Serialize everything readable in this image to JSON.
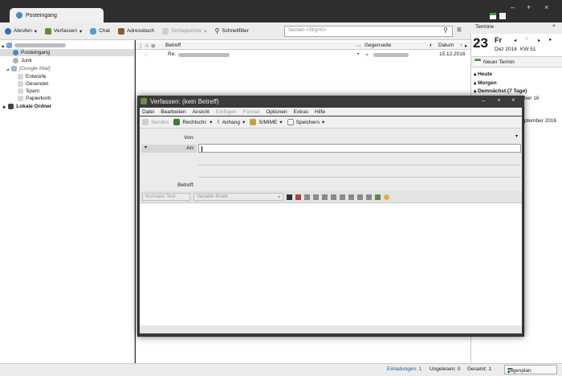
{
  "main": {
    "tab_title": "Posteingang",
    "toolbar": {
      "get_mail": "Abrufen",
      "compose": "Verfassen",
      "chat": "Chat",
      "address_book": "Adressbuch",
      "tags": "Schlagwörter",
      "quick_filter": "Schnellfilter"
    },
    "search_placeholder": "Suchen <Strg+K>"
  },
  "folders": {
    "inbox": "Posteingang",
    "junk": "Junk",
    "google_mail": "[Google Mail]",
    "drafts": "Entwürfe",
    "sent": "Gesendet",
    "spam": "Spam",
    "trash": "Papierkorb",
    "local_folders": "Lokale Ordner"
  },
  "message_list": {
    "columns": {
      "subject": "Betreff",
      "correspondent": "Gegenseite",
      "date": "Datum"
    },
    "rows": [
      {
        "subject_prefix": "Re:",
        "date": "15.12.2016"
      }
    ]
  },
  "today_pane": {
    "header": "Termine",
    "day": "23",
    "weekday": "Fr",
    "month_year": "Dez 2016",
    "week": "KW 51",
    "new_event": "Neuer Termin",
    "sections": [
      "Heute",
      "Morgen",
      "Demnächst (7 Tage)"
    ],
    "fragment_1": "ber 16",
    "fragment_2": "ptember 2016"
  },
  "status": {
    "invitations": "Einladungen: 1",
    "unread": "Ungelesen: 0",
    "total": "Gesamt: 1",
    "day_plan": "Tagesplan"
  },
  "compose": {
    "title": "Verfassen: (kein Betreff)",
    "menu": [
      "Datei",
      "Bearbeiten",
      "Ansicht",
      "Einfügen",
      "Format",
      "Optionen",
      "Extras",
      "Hilfe"
    ],
    "toolbar": {
      "send": "Senden",
      "spelling": "Rechtschr.",
      "attach": "Anhang",
      "smime": "S/MIME",
      "save": "Speichern"
    },
    "labels": {
      "from": "Von:",
      "to": "An:",
      "subject": "Betreff:"
    },
    "format": {
      "paragraph": "Normaler Text",
      "font": "Variable Breite"
    }
  },
  "colors": {
    "accent_blue": "#1f5fa8",
    "window_dark": "#3a3a3a",
    "calendar_green": "#3aa04a"
  }
}
